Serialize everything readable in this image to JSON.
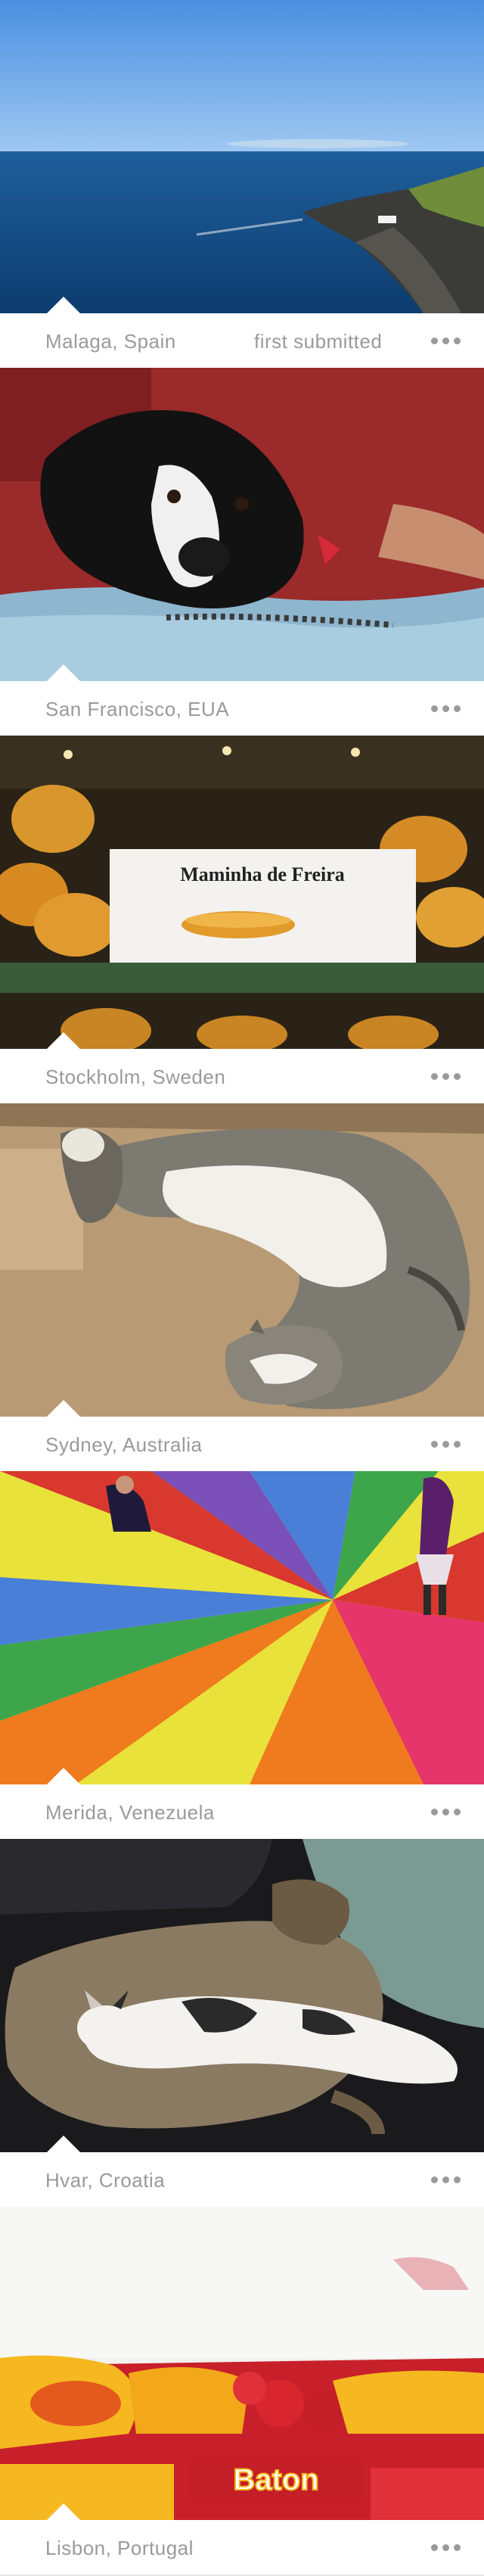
{
  "feed": {
    "cards": [
      {
        "location": "Malaga, Spain",
        "submitted": "first submitted",
        "photo": "coastline"
      },
      {
        "location": "San Francisco, EUA",
        "photo": "dog-on-blanket"
      },
      {
        "location": "Stockholm, Sweden",
        "photo": "pastries-display"
      },
      {
        "location": "Sydney, Australia",
        "photo": "cat-in-box"
      },
      {
        "location": "Merida, Venezuela",
        "photo": "parachute-game"
      },
      {
        "location": "Hvar, Croatia",
        "photo": "cat-and-dog-sleeping"
      },
      {
        "location": "Lisbon, Portugal",
        "photo": "candy-box"
      }
    ],
    "photo_texts": {
      "pastry_sign": "Maminha de Freira",
      "candy_brand": "Baton"
    },
    "more_icon": "more-dots-icon"
  }
}
